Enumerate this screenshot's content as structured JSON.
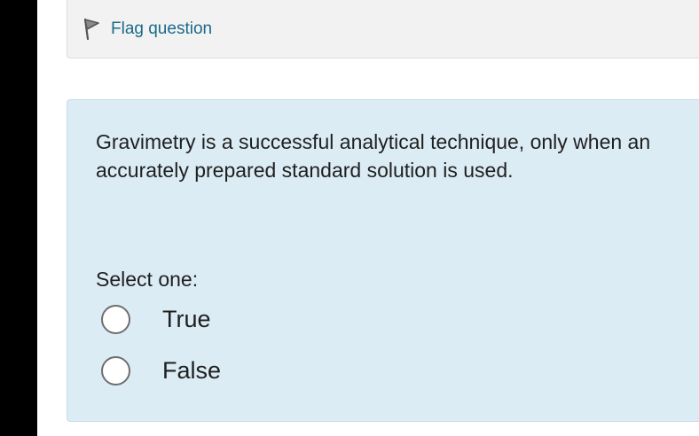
{
  "info": {
    "flag_label": "Flag question"
  },
  "question": {
    "text": "Gravimetry is a successful analytical technique, only when an accurately prepared standard solution is used.",
    "prompt": "Select one:",
    "options": [
      {
        "label": "True",
        "selected": false
      },
      {
        "label": "False",
        "selected": false
      }
    ]
  },
  "colors": {
    "link": "#1a6a8a",
    "question_bg": "#dcecf5",
    "info_bg": "#f2f2f2"
  },
  "icons": {
    "flag": "flag-icon"
  }
}
